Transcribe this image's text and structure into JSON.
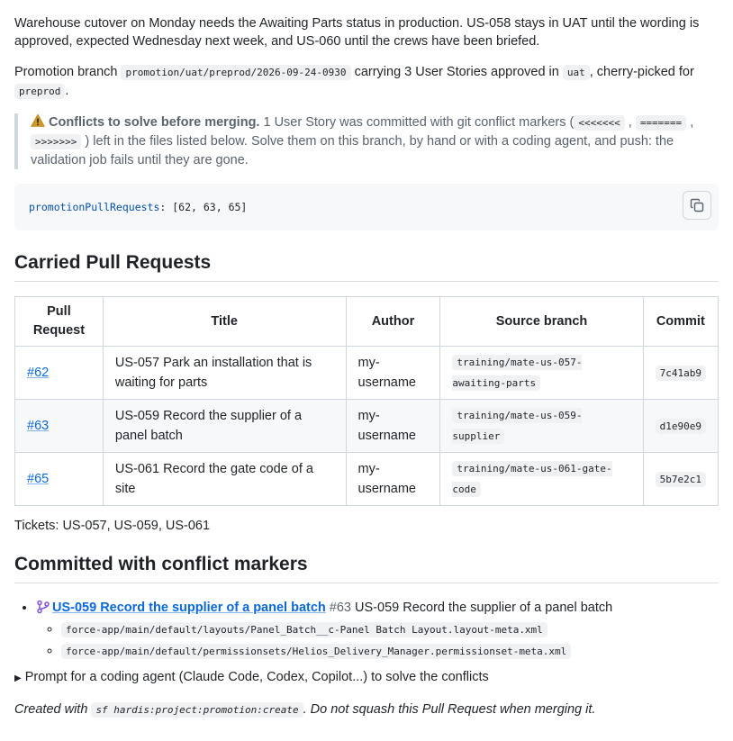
{
  "intro": {
    "paragraph": "Warehouse cutover on Monday needs the Awaiting Parts status in production. US-058 stays in UAT until the wording is approved, expected Wednesday next week, and US-060 until the crews have been briefed.",
    "promo_prefix": "Promotion branch",
    "promo_branch": "promotion/uat/preprod/2026-09-24-0930",
    "promo_mid": "carrying 3 User Stories approved in",
    "promo_env": "uat",
    "promo_mid2": ", cherry-picked for",
    "promo_target": "preprod",
    "promo_end": "."
  },
  "conflict_note": {
    "title": "Conflicts to solve before merging.",
    "text1": "1 User Story was committed with git conflict markers (",
    "marker1": "<<<<<<<",
    "sep1": ",",
    "marker2": "=======",
    "sep2": ",",
    "marker3": ">>>>>>>",
    "text2": ") left in the files listed below. Solve them on this branch, by hand or with a coding agent, and push: the validation job fails until they are gone."
  },
  "code_block": {
    "key": "promotionPullRequests",
    "value": ": [62, 63, 65]"
  },
  "carried": {
    "heading": "Carried Pull Requests",
    "headers": [
      "Pull Request",
      "Title",
      "Author",
      "Source branch",
      "Commit"
    ],
    "rows": [
      {
        "pr": "#62",
        "title": "US-057 Park an installation that is waiting for parts",
        "author": "my-username",
        "branch": "training/mate-us-057-awaiting-parts",
        "commit": "7c41ab9"
      },
      {
        "pr": "#63",
        "title": "US-059 Record the supplier of a panel batch",
        "author": "my-username",
        "branch": "training/mate-us-059-supplier",
        "commit": "d1e90e9"
      },
      {
        "pr": "#65",
        "title": "US-061 Record the gate code of a site",
        "author": "my-username",
        "branch": "training/mate-us-061-gate-code",
        "commit": "5b7e2c1"
      }
    ]
  },
  "tickets": "Tickets: US-057, US-059, US-061",
  "committed": {
    "heading": "Committed with conflict markers",
    "item": {
      "link_text": "US-059 Record the supplier of a panel batch",
      "pr_ref": "#63",
      "title": "US-059 Record the supplier of a panel batch",
      "files": [
        "force-app/main/default/layouts/Panel_Batch__c-Panel Batch Layout.layout-meta.xml",
        "force-app/main/default/permissionsets/Helios_Delivery_Manager.permissionset-meta.xml"
      ]
    }
  },
  "prompt_summary": "Prompt for a coding agent (Claude Code, Codex, Copilot...) to solve the conflicts",
  "footer": {
    "prefix": "Created with",
    "command": "sf hardis:project:promotion:create",
    "suffix": ". Do not squash this Pull Request when merging it."
  },
  "icons": {
    "warning": "warning-icon",
    "copy": "copy-icon",
    "branch": "git-branch-icon",
    "disclosure": "triangle-right-icon"
  },
  "colors": {
    "link": "#0969da",
    "warning": "#d29922",
    "branch_icon": "#8250df",
    "code_bg": "#eff1f3"
  }
}
